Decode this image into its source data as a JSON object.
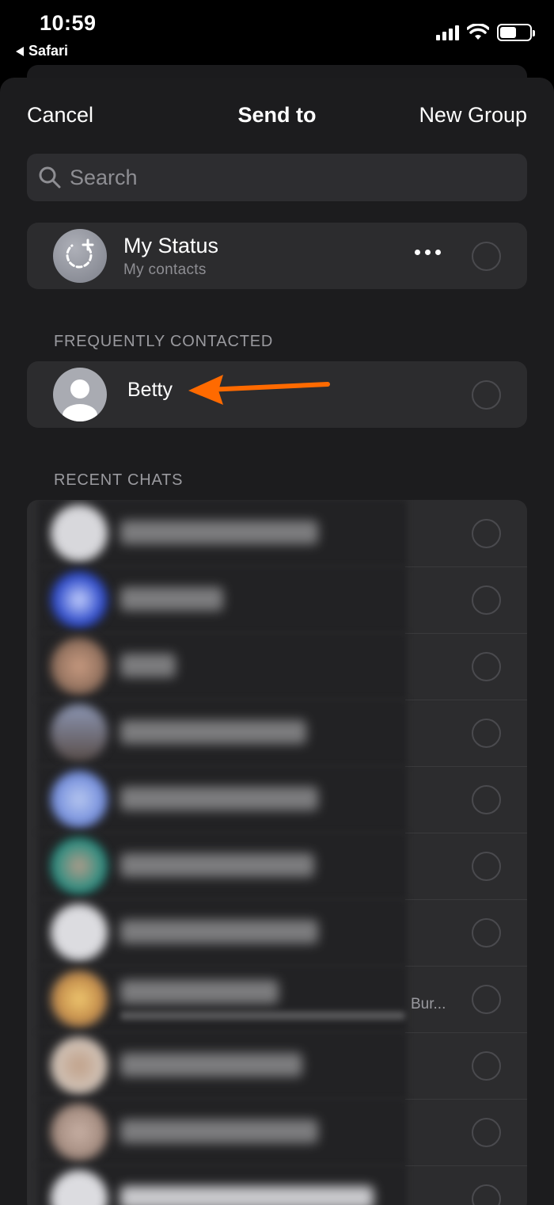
{
  "status_bar": {
    "time": "10:59",
    "back_app": "Safari"
  },
  "nav": {
    "cancel": "Cancel",
    "title": "Send to",
    "new_group": "New Group"
  },
  "search": {
    "placeholder": "Search"
  },
  "my_status": {
    "title": "My Status",
    "subtitle": "My contacts"
  },
  "frequently": {
    "header": "FREQUENTLY CONTACTED",
    "items": [
      {
        "name": "Betty"
      }
    ]
  },
  "recent": {
    "header": "RECENT CHATS",
    "visible_subtitle": "Bur..."
  },
  "colors": {
    "background": "#1c1c1e",
    "card": "#2c2c2e",
    "arrow": "#ff6a00",
    "secondary_text": "#8e8e93"
  }
}
